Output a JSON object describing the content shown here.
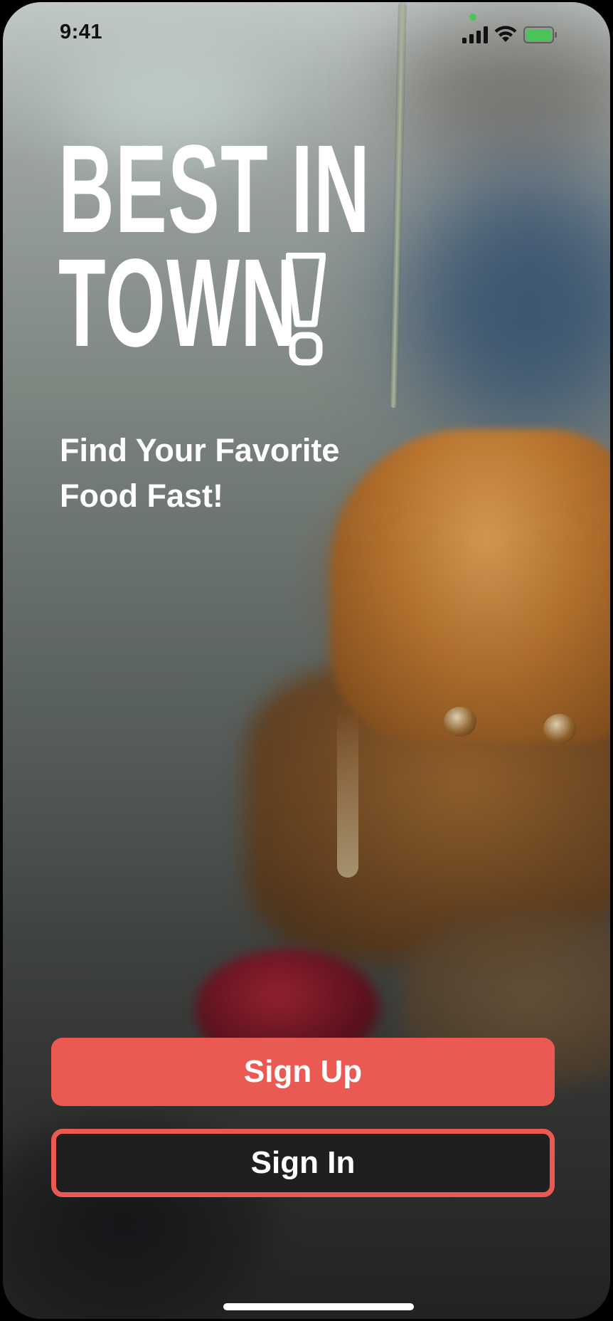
{
  "status_bar": {
    "time": "9:41",
    "signal_icon": "cellular-signal-icon",
    "wifi_icon": "wifi-icon",
    "battery_icon": "battery-icon",
    "camera_indicator_color": "#4cc35a"
  },
  "logo": {
    "line1": "BEST IN",
    "line2": "TOWN"
  },
  "tagline": {
    "line1": "Find Your Favorite",
    "line2": "Food Fast!"
  },
  "actions": {
    "sign_up_label": "Sign Up",
    "sign_in_label": "Sign In"
  },
  "colors": {
    "accent": "#ea5a52",
    "secondary_button_bg": "#1f1f20",
    "text_on_dark": "#ffffff"
  }
}
